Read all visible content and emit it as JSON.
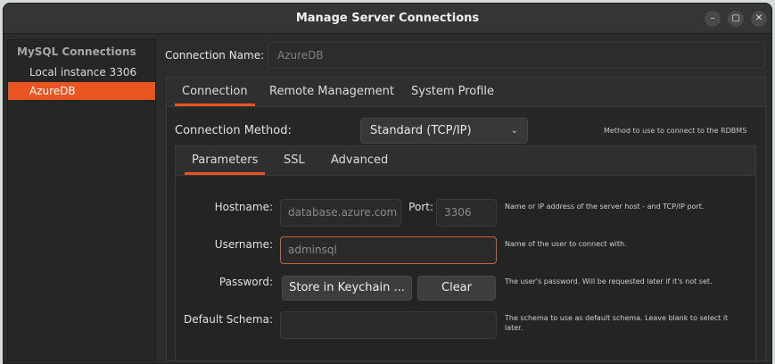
{
  "window": {
    "title": "Manage Server Connections",
    "controls": {
      "minimize": "–",
      "maximize": "▢",
      "close": "✕"
    }
  },
  "sidebar": {
    "header": "MySQL Connections",
    "items": [
      {
        "label": "Local instance 3306",
        "selected": false
      },
      {
        "label": "AzureDB",
        "selected": true
      }
    ]
  },
  "connection_name": {
    "label": "Connection Name:",
    "value": "AzureDB"
  },
  "outer_tabs": [
    {
      "label": "Connection",
      "active": true
    },
    {
      "label": "Remote Management",
      "active": false
    },
    {
      "label": "System Profile",
      "active": false
    }
  ],
  "connection_method": {
    "label": "Connection Method:",
    "value": "Standard (TCP/IP)",
    "help": "Method to use to connect to the RDBMS"
  },
  "inner_tabs": [
    {
      "label": "Parameters",
      "active": true
    },
    {
      "label": "SSL",
      "active": false
    },
    {
      "label": "Advanced",
      "active": false
    }
  ],
  "params": {
    "hostname": {
      "label": "Hostname:",
      "value": "database.azure.com"
    },
    "port": {
      "label": "Port:",
      "value": "3306"
    },
    "host_help": "Name or IP address of the server host - and TCP/IP port.",
    "username": {
      "label": "Username:",
      "value": "adminsql",
      "help": "Name of the user to connect with."
    },
    "password": {
      "label": "Password:",
      "store_button": "Store in Keychain ...",
      "clear_button": "Clear",
      "help": "The user's password. Will be requested later if it's not set."
    },
    "schema": {
      "label": "Default Schema:",
      "value": "",
      "help": "The schema to use as default schema. Leave blank to select it later."
    }
  },
  "colors": {
    "accent": "#e95420"
  }
}
